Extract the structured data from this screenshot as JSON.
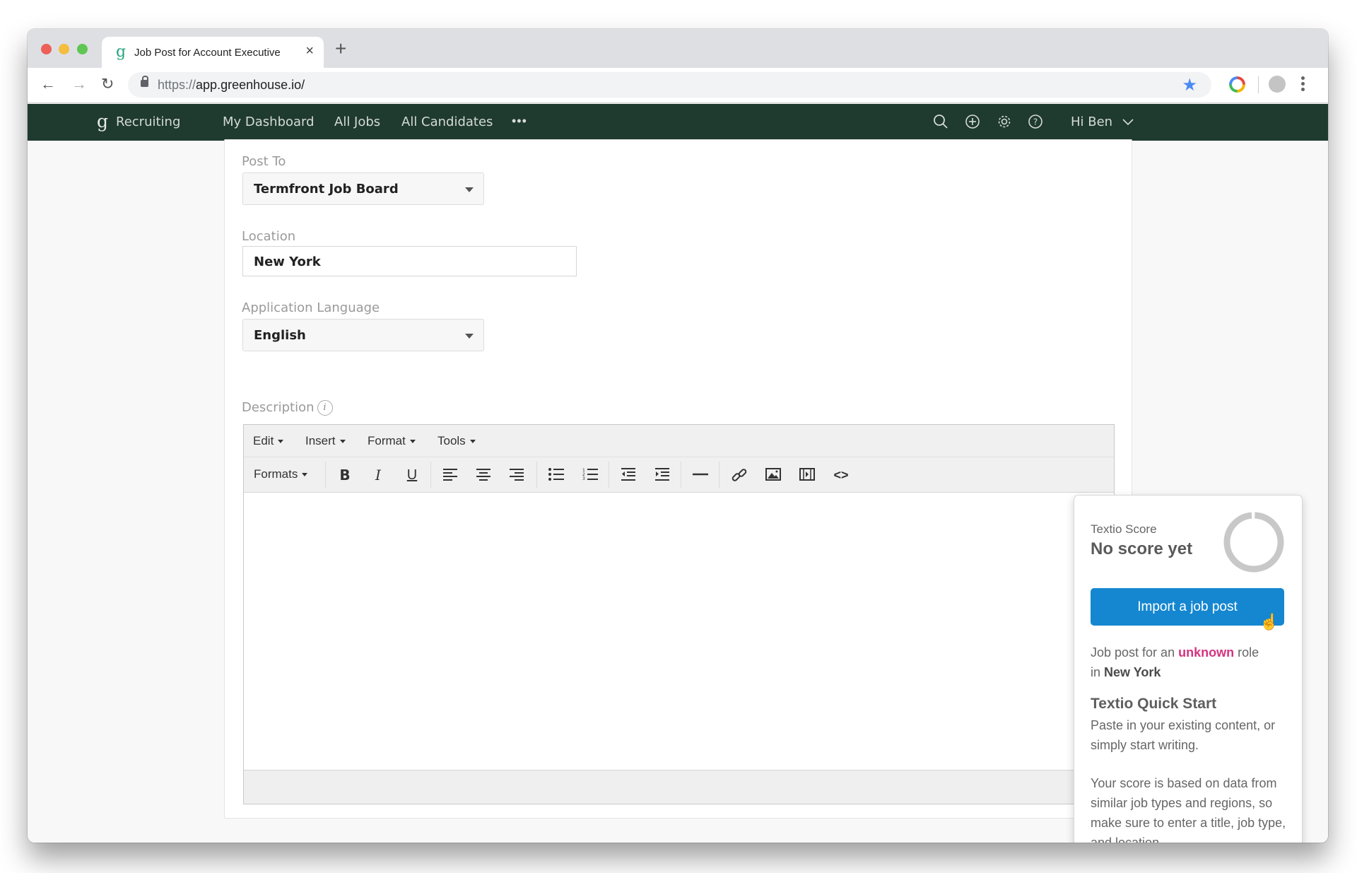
{
  "browser": {
    "tab_title": "Job Post for Account Executive",
    "tab_close": "×",
    "new_tab": "+",
    "url_scheme": "https://",
    "url_host": "app.greenhouse.io/",
    "back": "←",
    "forward": "→",
    "reload": "↻",
    "bookmark": "★"
  },
  "appnav": {
    "brand_glyph": "g",
    "brand": "Recruiting",
    "links": [
      "My Dashboard",
      "All Jobs",
      "All Candidates"
    ],
    "more": "•••",
    "greeting": "Hi Ben",
    "icons": [
      "search-icon",
      "add-icon",
      "settings-icon",
      "help-icon"
    ]
  },
  "form": {
    "post_to": {
      "label": "Post To",
      "value": "Termfront Job Board"
    },
    "location": {
      "label": "Location",
      "value": "New York"
    },
    "language": {
      "label": "Application Language",
      "value": "English"
    },
    "description": {
      "label": "Description",
      "info": "i"
    }
  },
  "editor": {
    "menus": [
      "Edit",
      "Insert",
      "Format",
      "Tools"
    ],
    "formats": "Formats",
    "bold": "B",
    "italic": "I",
    "underline": "U",
    "code": "<>",
    "content": ""
  },
  "textio": {
    "score_label": "Textio Score",
    "score_value": "No score yet",
    "import_button": "Import a job post",
    "role_prefix": "Job post for an ",
    "role_value": "unknown",
    "role_suffix": " role",
    "in_prefix": "in ",
    "location_value": "New York",
    "quickstart_title": "Textio Quick Start",
    "quickstart_text": "Paste in your existing content, or simply start writing.",
    "score_info": "Your score is based on data from similar job types and regions, so make sure to enter a title, job type, and location.",
    "accent_color": "#d6337f",
    "button_color": "#1587d0"
  }
}
